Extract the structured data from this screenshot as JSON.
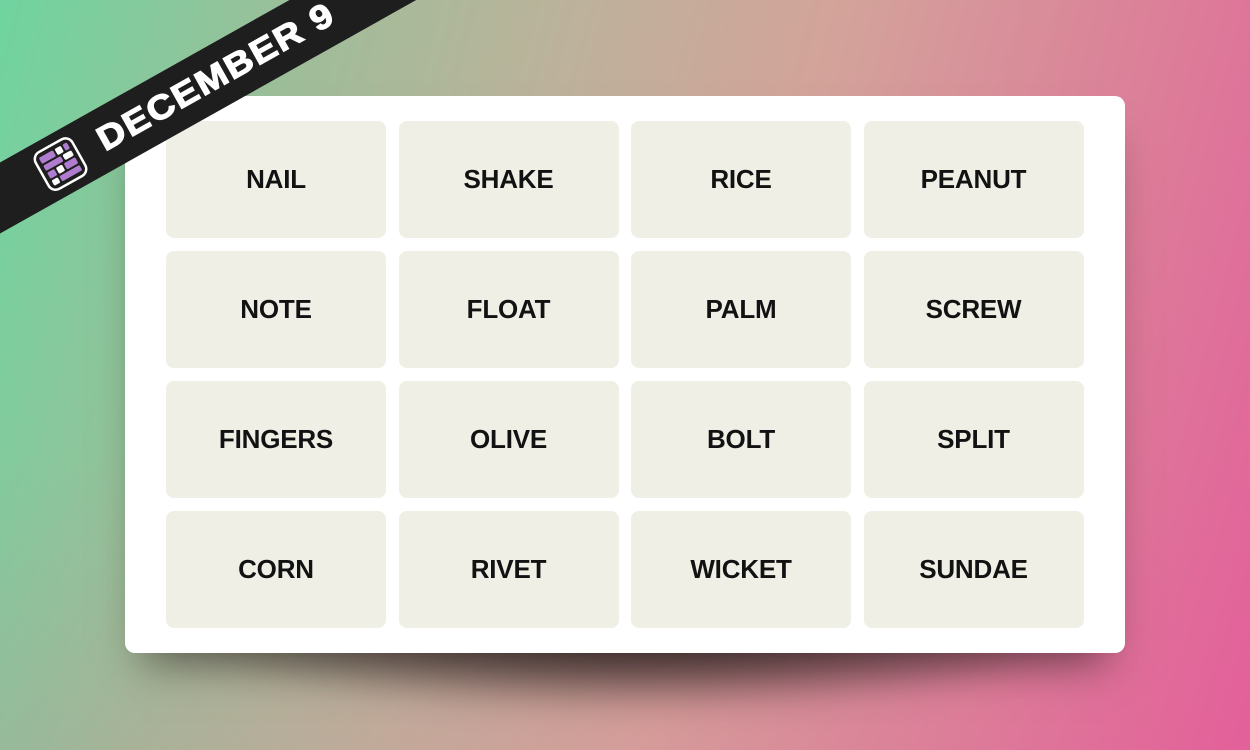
{
  "banner": {
    "date_label": "DECEMBER 9",
    "icon": "connections-grid-icon",
    "background_color": "#1e1e1e",
    "icon_accent_color": "#b07ccf"
  },
  "board": {
    "tile_color": "#efefe6",
    "text_color": "#121212",
    "rows": [
      [
        "NAIL",
        "SHAKE",
        "RICE",
        "PEANUT"
      ],
      [
        "NOTE",
        "FLOAT",
        "PALM",
        "SCREW"
      ],
      [
        "FINGERS",
        "OLIVE",
        "BOLT",
        "SPLIT"
      ],
      [
        "CORN",
        "RIVET",
        "WICKET",
        "SUNDAE"
      ]
    ]
  }
}
